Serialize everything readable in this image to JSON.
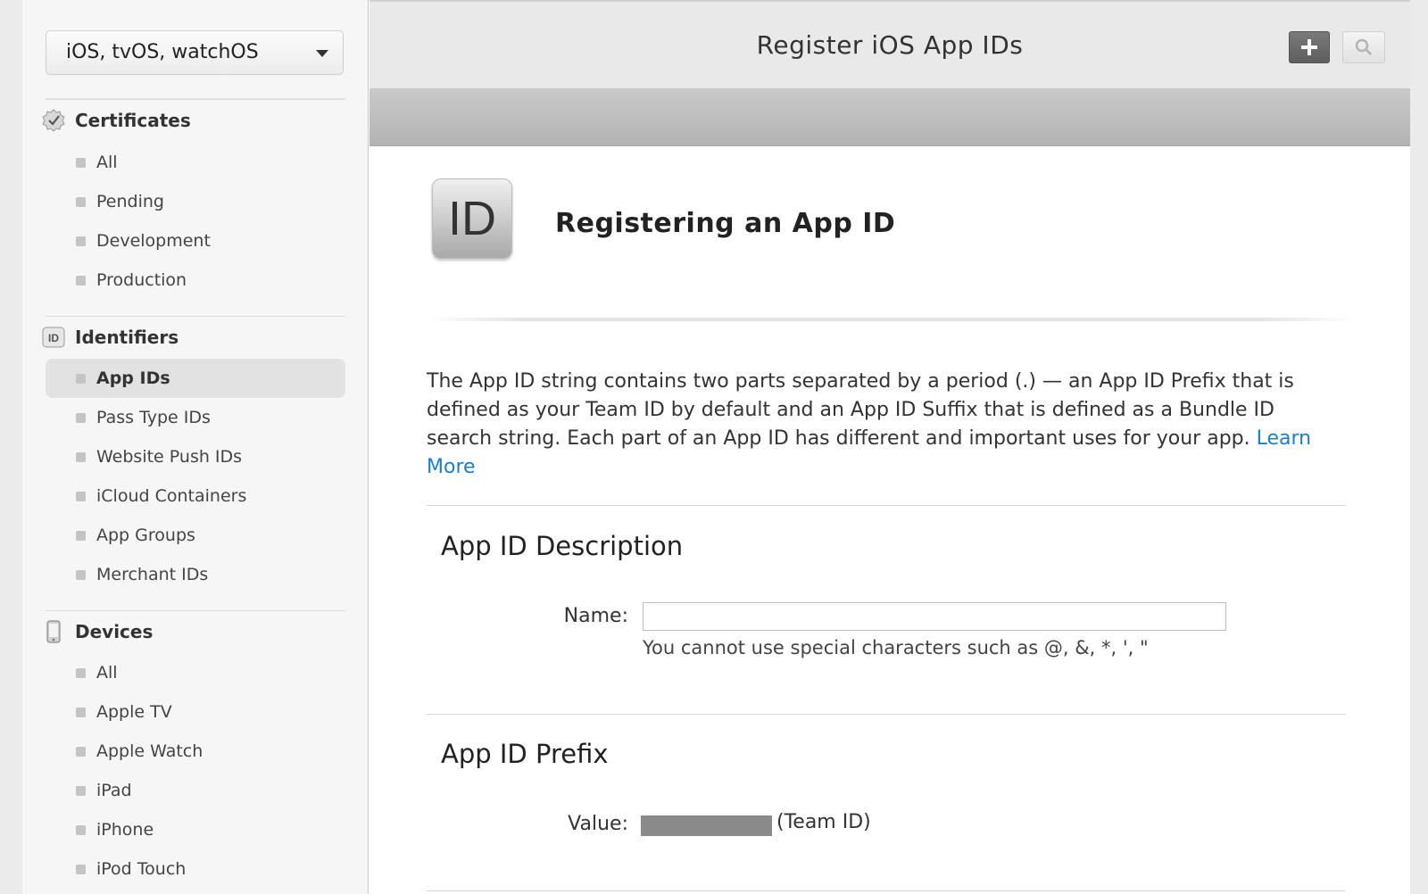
{
  "sidebar": {
    "platform_select": "iOS, tvOS, watchOS",
    "sections": [
      {
        "title": "Certificates",
        "icon": "certificate-icon",
        "items": [
          "All",
          "Pending",
          "Development",
          "Production"
        ]
      },
      {
        "title": "Identifiers",
        "icon": "identifiers-icon",
        "icon_text": "ID",
        "items": [
          "App IDs",
          "Pass Type IDs",
          "Website Push IDs",
          "iCloud Containers",
          "App Groups",
          "Merchant IDs"
        ],
        "active_item": "App IDs"
      },
      {
        "title": "Devices",
        "icon": "device-icon",
        "items": [
          "All",
          "Apple TV",
          "Apple Watch",
          "iPad",
          "iPhone",
          "iPod Touch"
        ]
      }
    ]
  },
  "header": {
    "title": "Register iOS App IDs",
    "add_button": "plus-icon",
    "search_button": "search-icon"
  },
  "main": {
    "badge_text": "ID",
    "heading": "Registering an App ID",
    "intro": "The App ID string contains two parts separated by a period (.) — an App ID Prefix that is defined as your Team ID by default and an App ID Suffix that is defined as a Bundle ID search string. Each part of an App ID has different and important uses for your app.",
    "learn_more": "Learn More",
    "description": {
      "heading": "App ID Description",
      "name_label": "Name:",
      "name_value": "",
      "hint": "You cannot use special characters such as @, &, *, ', \""
    },
    "prefix": {
      "heading": "App ID Prefix",
      "value_label": "Value:",
      "team_label": "(Team ID)"
    }
  },
  "colors": {
    "link": "#1a7fc7",
    "active_item_bg": "#e2e2e2",
    "redaction": "#8a8a8a"
  }
}
